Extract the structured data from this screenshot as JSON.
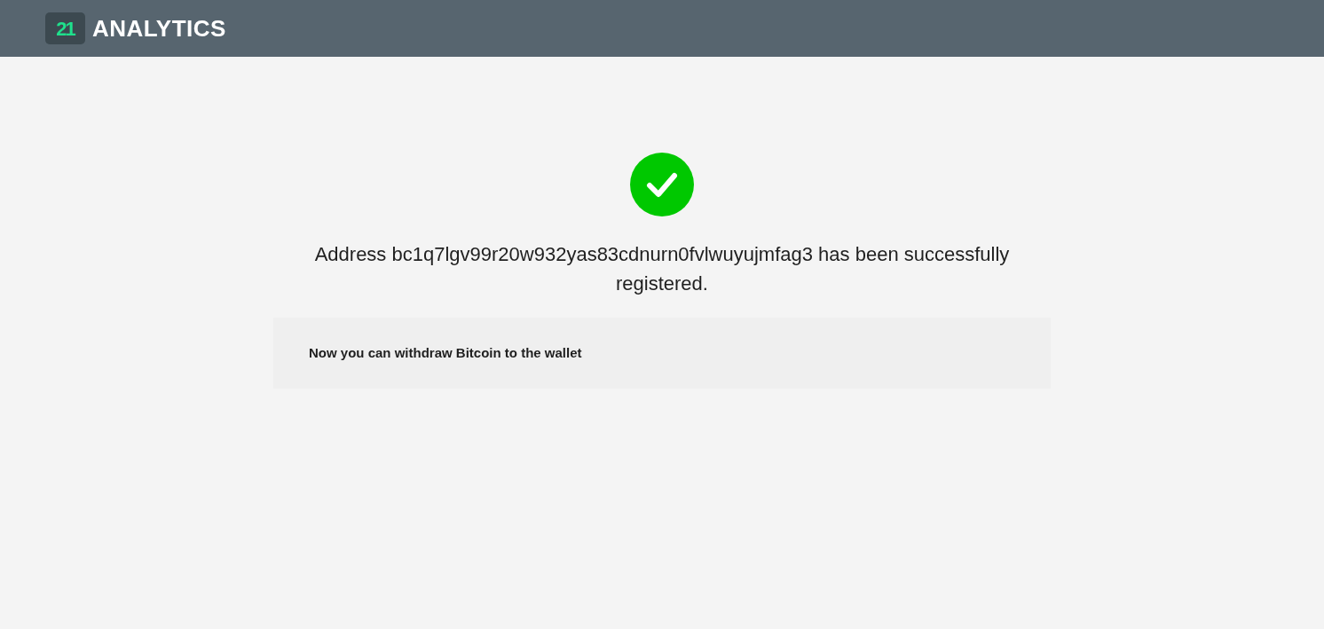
{
  "header": {
    "logo_badge": "21",
    "logo_text": "ANALYTICS"
  },
  "success": {
    "message": "Address bc1q7lgv99r20w932yas83cdnurn0fvlwuyujmfag3 has been successfully registered."
  },
  "note": {
    "text": "Now you can withdraw Bitcoin to the wallet"
  }
}
